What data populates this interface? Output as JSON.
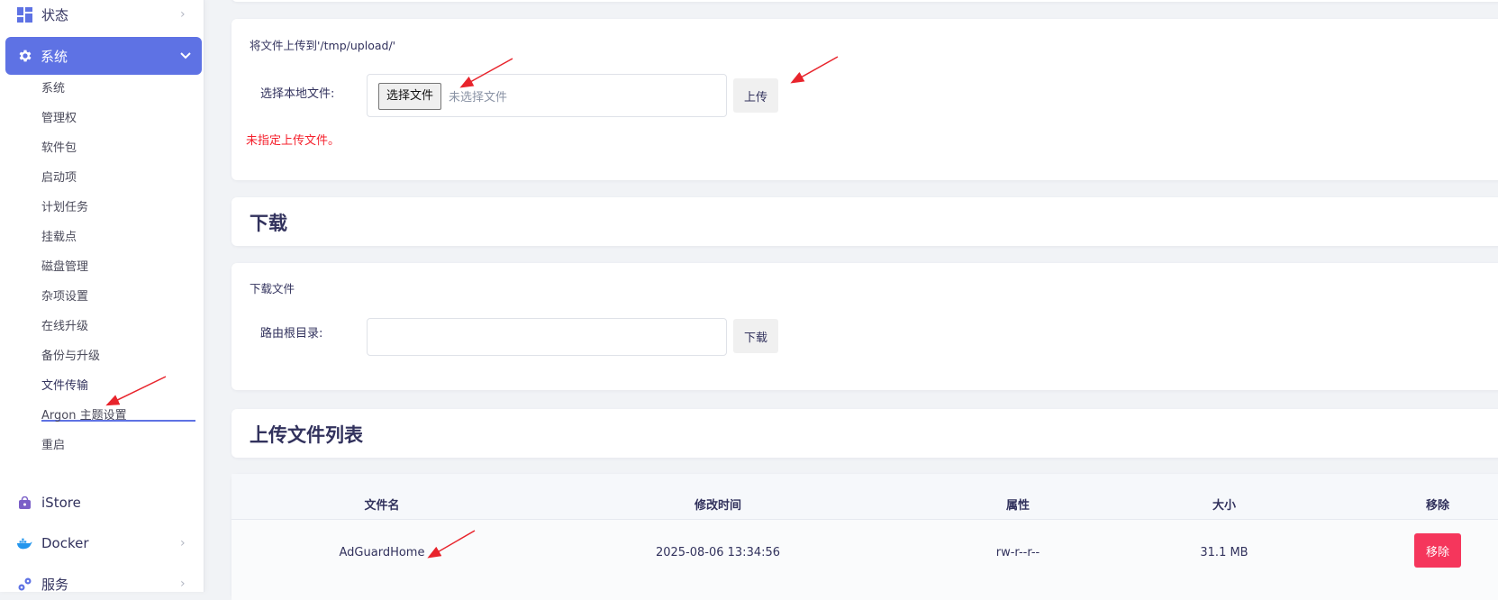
{
  "sidebar": {
    "status_label": "状态",
    "system_label": "系统",
    "sub_items": [
      "系统",
      "管理权",
      "软件包",
      "启动项",
      "计划任务",
      "挂载点",
      "磁盘管理",
      "杂项设置",
      "在线升级",
      "备份与升级",
      "文件传输",
      "Argon 主题设置",
      "重启"
    ],
    "active_sub": "文件传输",
    "istore_label": "iStore",
    "docker_label": "Docker",
    "services_label": "服务"
  },
  "upload": {
    "description": "将文件上传到'/tmp/upload/'",
    "field_label": "选择本地文件:",
    "choose_button": "选择文件",
    "no_file_text": "未选择文件",
    "upload_button": "上传",
    "error_text": "未指定上传文件。"
  },
  "download": {
    "title": "下载",
    "description": "下载文件",
    "field_label": "路由根目录:",
    "input_value": "",
    "download_button": "下载"
  },
  "file_list": {
    "title": "上传文件列表",
    "headers": [
      "文件名",
      "修改时间",
      "属性",
      "大小",
      "移除"
    ],
    "rows": [
      {
        "name": "AdGuardHome",
        "modified": "2025-08-06 13:34:56",
        "attributes": "rw-r--r--",
        "size": "31.1 MB",
        "action": "移除"
      }
    ]
  },
  "colors": {
    "accent": "#5e72e4",
    "danger": "#f5365c",
    "error_text": "#f5202c",
    "annotation_arrow": "#e8242c"
  }
}
